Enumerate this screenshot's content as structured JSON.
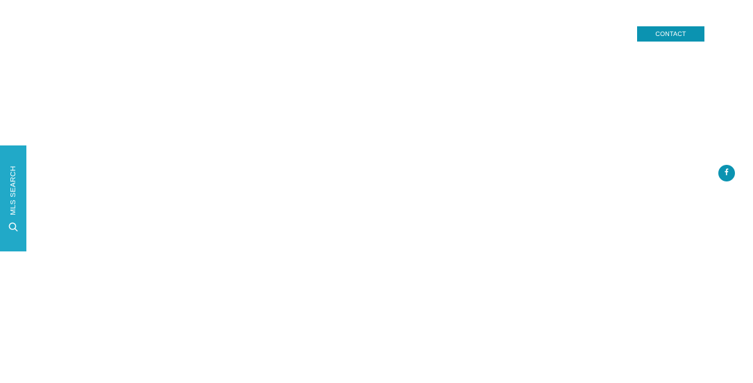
{
  "header": {
    "contact_label": "CONTACT"
  },
  "mls_tab": {
    "label": "MLS SEARCH",
    "icon": "search-icon"
  },
  "social": {
    "facebook_icon": "facebook-icon"
  },
  "colors": {
    "contact_button_bg": "#0b93b1",
    "mls_tab_bg": "#21a9c8",
    "facebook_bg": "#0b93b1",
    "page_bg": "#ffffff"
  }
}
